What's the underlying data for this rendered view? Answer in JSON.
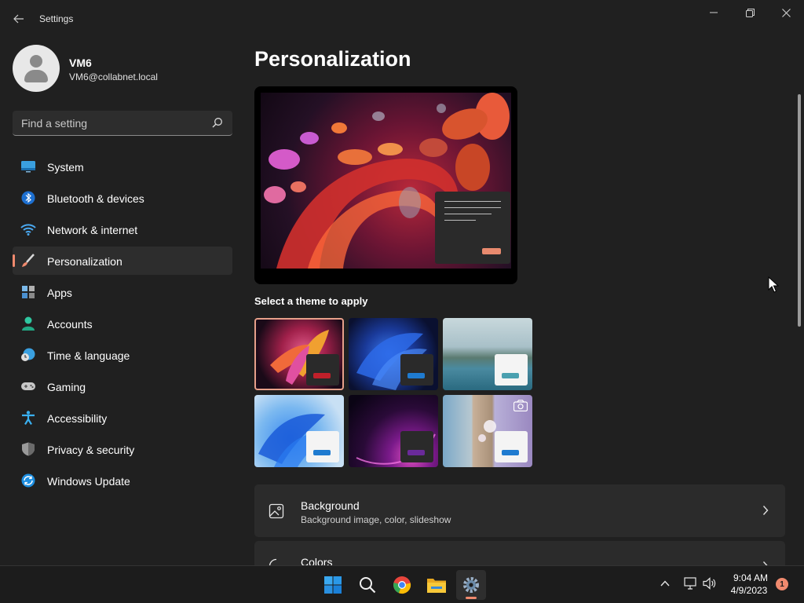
{
  "window": {
    "title": "Settings",
    "back_icon": "arrow-left-icon",
    "minimize_icon": "minimize-icon",
    "restore_icon": "restore-icon",
    "close_icon": "close-icon"
  },
  "profile": {
    "name": "VM6",
    "email": "VM6@collabnet.local"
  },
  "search": {
    "placeholder": "Find a setting",
    "value": "",
    "icon": "search-icon"
  },
  "sidebar": {
    "items": [
      {
        "label": "System",
        "icon": "system-icon",
        "active": false
      },
      {
        "label": "Bluetooth & devices",
        "icon": "bluetooth-icon",
        "active": false
      },
      {
        "label": "Network & internet",
        "icon": "wifi-icon",
        "active": false
      },
      {
        "label": "Personalization",
        "icon": "brush-icon",
        "active": true
      },
      {
        "label": "Apps",
        "icon": "apps-icon",
        "active": false
      },
      {
        "label": "Accounts",
        "icon": "accounts-icon",
        "active": false
      },
      {
        "label": "Time & language",
        "icon": "time-language-icon",
        "active": false
      },
      {
        "label": "Gaming",
        "icon": "gamepad-icon",
        "active": false
      },
      {
        "label": "Accessibility",
        "icon": "accessibility-icon",
        "active": false
      },
      {
        "label": "Privacy & security",
        "icon": "shield-icon",
        "active": false
      },
      {
        "label": "Windows Update",
        "icon": "update-icon",
        "active": false
      }
    ]
  },
  "main": {
    "title": "Personalization",
    "theme_heading": "Select a theme to apply",
    "themes": [
      {
        "id": "glow",
        "selected": true,
        "accent": "#c0202a"
      },
      {
        "id": "windows-dark",
        "selected": false,
        "accent": "#1f7bd0"
      },
      {
        "id": "captured-motion",
        "selected": false,
        "accent": "#4aa0b0"
      },
      {
        "id": "windows-light",
        "selected": false,
        "accent": "#1f7bd0"
      },
      {
        "id": "sunrise",
        "selected": false,
        "accent": "#6a2a9a"
      },
      {
        "id": "flow",
        "selected": false,
        "accent": "#1f7bd0"
      }
    ],
    "cards": [
      {
        "title": "Background",
        "subtitle": "Background image, color, slideshow",
        "icon": "image-icon"
      },
      {
        "title": "Colors",
        "subtitle": "",
        "icon": "palette-icon"
      }
    ]
  },
  "taskbar": {
    "apps": [
      {
        "name": "start",
        "icon": "windows-logo-icon",
        "active": false
      },
      {
        "name": "search",
        "icon": "search-icon",
        "active": false
      },
      {
        "name": "chrome",
        "icon": "chrome-icon",
        "active": false
      },
      {
        "name": "file-explorer",
        "icon": "folder-icon",
        "active": false
      },
      {
        "name": "settings",
        "icon": "gear-icon",
        "active": true
      }
    ],
    "tray": {
      "time": "9:04 AM",
      "date": "4/9/2023",
      "notification_count": "1"
    }
  },
  "colors": {
    "accent": "#f08a6e",
    "background": "#202020",
    "card": "#2b2b2b"
  }
}
